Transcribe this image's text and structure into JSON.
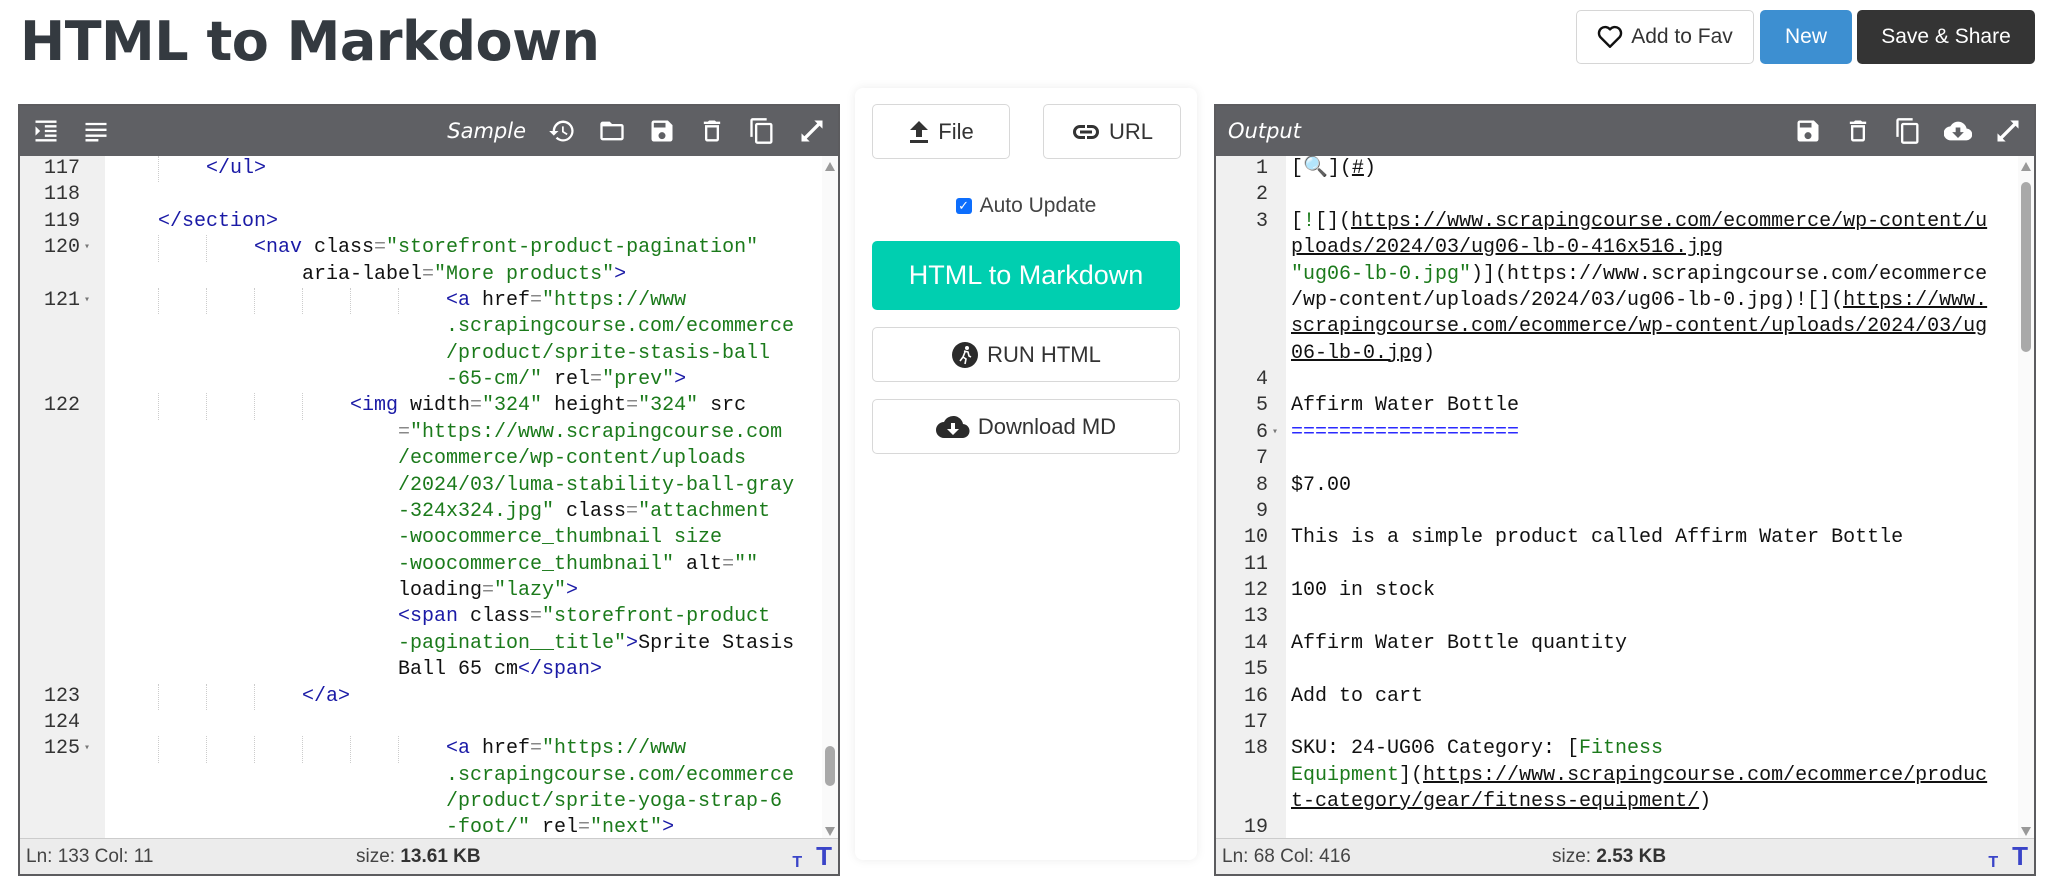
{
  "header": {
    "title": "HTML to Markdown",
    "fav_label": "Add to Fav",
    "new_label": "New",
    "save_label": "Save & Share"
  },
  "colors": {
    "accent_green": "#00cfb0",
    "new_blue": "#3d8fd1",
    "toolbar": "#5f6064"
  },
  "editor": {
    "toolbar_label": "Sample",
    "status_pos": "Ln: 133 Col: 11",
    "size_label": "size:",
    "size_value": "13.61 KB",
    "font_small": "T",
    "font_large": "T",
    "lines": [
      {
        "n": "117",
        "col": 8,
        "g": [
          4
        ],
        "segs": [
          [
            "t",
            "</ul>"
          ]
        ]
      },
      {
        "n": "118",
        "col": 0,
        "g": [],
        "segs": []
      },
      {
        "n": "119",
        "col": 4,
        "g": [],
        "segs": [
          [
            "t",
            "</section>"
          ]
        ]
      },
      {
        "n": "120",
        "fold": true,
        "col": 12,
        "g": [
          4,
          8
        ],
        "segs": [
          [
            "t",
            "<nav "
          ],
          [
            "a",
            "class"
          ],
          [
            "e",
            "="
          ],
          [
            "s",
            "\"storefront-product-pagination\""
          ]
        ]
      },
      {
        "n": "",
        "col": 16,
        "g": [],
        "segs": [
          [
            "a",
            "aria-label"
          ],
          [
            "e",
            "="
          ],
          [
            "s",
            "\"More products\""
          ],
          [
            "t",
            ">"
          ]
        ]
      },
      {
        "n": "121",
        "fold": true,
        "col": 28,
        "g": [
          4,
          8,
          12,
          16,
          20,
          24
        ],
        "segs": [
          [
            "t",
            "<a "
          ],
          [
            "a",
            "href"
          ],
          [
            "e",
            "="
          ],
          [
            "s",
            "\"https://www"
          ]
        ]
      },
      {
        "n": "",
        "col": 28,
        "g": [],
        "segs": [
          [
            "s",
            ".scrapingcourse.com/ecommerce"
          ]
        ]
      },
      {
        "n": "",
        "col": 28,
        "g": [],
        "segs": [
          [
            "s",
            "/product/sprite-stasis-ball"
          ]
        ]
      },
      {
        "n": "",
        "col": 28,
        "g": [],
        "segs": [
          [
            "s",
            "-65-cm/\" "
          ],
          [
            "a",
            "rel"
          ],
          [
            "e",
            "="
          ],
          [
            "s",
            "\"prev\""
          ],
          [
            "t",
            ">"
          ]
        ]
      },
      {
        "n": "122",
        "col": 20,
        "g": [
          4,
          8,
          12,
          16
        ],
        "segs": [
          [
            "t",
            "<img "
          ],
          [
            "a",
            "width"
          ],
          [
            "e",
            "="
          ],
          [
            "s",
            "\"324\" "
          ],
          [
            "a",
            "height"
          ],
          [
            "e",
            "="
          ],
          [
            "s",
            "\"324\" "
          ],
          [
            "a",
            "src"
          ]
        ]
      },
      {
        "n": "",
        "col": 24,
        "g": [],
        "segs": [
          [
            "e",
            "="
          ],
          [
            "s",
            "\"https://www.scrapingcourse.com"
          ]
        ]
      },
      {
        "n": "",
        "col": 24,
        "g": [],
        "segs": [
          [
            "s",
            "/ecommerce/wp-content/uploads"
          ]
        ]
      },
      {
        "n": "",
        "col": 24,
        "g": [],
        "segs": [
          [
            "s",
            "/2024/03/luma-stability-ball-gray"
          ]
        ]
      },
      {
        "n": "",
        "col": 24,
        "g": [],
        "segs": [
          [
            "s",
            "-324x324.jpg\" "
          ],
          [
            "a",
            "class"
          ],
          [
            "e",
            "="
          ],
          [
            "s",
            "\"attachment"
          ]
        ]
      },
      {
        "n": "",
        "col": 24,
        "g": [],
        "segs": [
          [
            "s",
            "-woocommerce_thumbnail size"
          ]
        ]
      },
      {
        "n": "",
        "col": 24,
        "g": [],
        "segs": [
          [
            "s",
            "-woocommerce_thumbnail\" "
          ],
          [
            "a",
            "alt"
          ],
          [
            "e",
            "="
          ],
          [
            "s",
            "\"\""
          ]
        ]
      },
      {
        "n": "",
        "col": 24,
        "g": [],
        "segs": [
          [
            "a",
            "loading"
          ],
          [
            "e",
            "="
          ],
          [
            "s",
            "\"lazy\""
          ],
          [
            "t",
            ">"
          ]
        ]
      },
      {
        "n": "",
        "col": 24,
        "g": [],
        "segs": [
          [
            "t",
            "<span "
          ],
          [
            "a",
            "class"
          ],
          [
            "e",
            "="
          ],
          [
            "s",
            "\"storefront-product"
          ]
        ]
      },
      {
        "n": "",
        "col": 24,
        "g": [],
        "segs": [
          [
            "s",
            "-pagination__title\""
          ],
          [
            "t",
            ">"
          ],
          [
            "x",
            "Sprite Stasis"
          ]
        ]
      },
      {
        "n": "",
        "col": 24,
        "g": [],
        "segs": [
          [
            "x",
            "Ball 65 cm"
          ],
          [
            "t",
            "</span>"
          ]
        ]
      },
      {
        "n": "123",
        "col": 16,
        "g": [
          4,
          8,
          12
        ],
        "segs": [
          [
            "t",
            "</a>"
          ]
        ]
      },
      {
        "n": "124",
        "col": 0,
        "g": [],
        "segs": []
      },
      {
        "n": "125",
        "fold": true,
        "col": 28,
        "g": [
          4,
          8,
          12,
          16,
          20,
          24
        ],
        "segs": [
          [
            "t",
            "<a "
          ],
          [
            "a",
            "href"
          ],
          [
            "e",
            "="
          ],
          [
            "s",
            "\"https://www"
          ]
        ]
      },
      {
        "n": "",
        "col": 28,
        "g": [],
        "segs": [
          [
            "s",
            ".scrapingcourse.com/ecommerce"
          ]
        ]
      },
      {
        "n": "",
        "col": 28,
        "g": [],
        "segs": [
          [
            "s",
            "/product/sprite-yoga-strap-6"
          ]
        ]
      },
      {
        "n": "",
        "col": 28,
        "g": [],
        "segs": [
          [
            "s",
            "-foot/\" "
          ],
          [
            "a",
            "rel"
          ],
          [
            "e",
            "="
          ],
          [
            "s",
            "\"next\""
          ],
          [
            "t",
            ">"
          ]
        ]
      }
    ]
  },
  "output": {
    "toolbar_label": "Output",
    "status_pos": "Ln: 68 Col: 416",
    "size_label": "size:",
    "size_value": "2.53 KB",
    "font_small": "T",
    "font_large": "T",
    "lines": [
      {
        "n": "1",
        "col": 0,
        "segs": [
          [
            "x",
            "[🔍]("
          ],
          [
            "u",
            "#"
          ],
          [
            "x",
            ")"
          ]
        ]
      },
      {
        "n": "2",
        "col": 0,
        "segs": []
      },
      {
        "n": "3",
        "col": 0,
        "segs": [
          [
            "x",
            "["
          ],
          [
            "g",
            "!"
          ],
          [
            "x",
            "[]("
          ],
          [
            "u",
            "https://www.scrapingcourse.com/ecommerce/wp-content/u"
          ]
        ]
      },
      {
        "n": "",
        "col": 0,
        "segs": [
          [
            "u",
            "ploads/2024/03/ug06-lb-0-416x516.jpg"
          ]
        ]
      },
      {
        "n": "",
        "col": 0,
        "segs": [
          [
            "g",
            "\"ug06-lb-0.jpg\""
          ],
          [
            "x",
            ")](https://www.scrapingcourse.com/ecommerce"
          ]
        ]
      },
      {
        "n": "",
        "col": 0,
        "segs": [
          [
            "x",
            "/wp-content/uploads/2024/03/ug06-lb-0.jpg)![]("
          ],
          [
            "u",
            "https://www."
          ]
        ]
      },
      {
        "n": "",
        "col": 0,
        "segs": [
          [
            "u",
            "scrapingcourse.com/ecommerce/wp-content/uploads/2024/03/ug"
          ]
        ]
      },
      {
        "n": "",
        "col": 0,
        "segs": [
          [
            "u",
            "06-lb-0.jpg"
          ],
          [
            "x",
            ")"
          ]
        ]
      },
      {
        "n": "4",
        "col": 0,
        "segs": []
      },
      {
        "n": "5",
        "col": 0,
        "segs": [
          [
            "x",
            "Affirm Water Bottle"
          ]
        ]
      },
      {
        "n": "6",
        "fold": true,
        "col": 0,
        "segs": [
          [
            "h",
            "==================="
          ]
        ]
      },
      {
        "n": "7",
        "col": 0,
        "segs": []
      },
      {
        "n": "8",
        "col": 0,
        "segs": [
          [
            "x",
            "$7.00"
          ]
        ]
      },
      {
        "n": "9",
        "col": 0,
        "segs": []
      },
      {
        "n": "10",
        "col": 0,
        "segs": [
          [
            "x",
            "This is a simple product called Affirm Water Bottle"
          ]
        ]
      },
      {
        "n": "11",
        "col": 0,
        "segs": []
      },
      {
        "n": "12",
        "col": 0,
        "segs": [
          [
            "x",
            "100 in stock"
          ]
        ]
      },
      {
        "n": "13",
        "col": 0,
        "segs": []
      },
      {
        "n": "14",
        "col": 0,
        "segs": [
          [
            "x",
            "Affirm Water Bottle quantity"
          ]
        ]
      },
      {
        "n": "15",
        "col": 0,
        "segs": []
      },
      {
        "n": "16",
        "col": 0,
        "segs": [
          [
            "x",
            "Add to cart"
          ]
        ]
      },
      {
        "n": "17",
        "col": 0,
        "segs": []
      },
      {
        "n": "18",
        "col": 0,
        "segs": [
          [
            "x",
            "SKU: 24-UG06 Category: ["
          ],
          [
            "g",
            "Fitness"
          ]
        ]
      },
      {
        "n": "",
        "col": 0,
        "segs": [
          [
            "g",
            "Equipment"
          ],
          [
            "x",
            "]("
          ],
          [
            "u",
            "https://www.scrapingcourse.com/ecommerce/produc"
          ]
        ]
      },
      {
        "n": "",
        "col": 0,
        "segs": [
          [
            "u",
            "t-category/gear/fitness-equipment/"
          ],
          [
            "x",
            ")"
          ]
        ]
      },
      {
        "n": "19",
        "col": 0,
        "segs": []
      }
    ]
  },
  "controls": {
    "file_label": "File",
    "url_label": "URL",
    "auto_update_label": "Auto Update",
    "auto_update_checked": true,
    "convert_label": "HTML to Markdown",
    "run_label": "RUN HTML",
    "download_label": "Download MD"
  }
}
